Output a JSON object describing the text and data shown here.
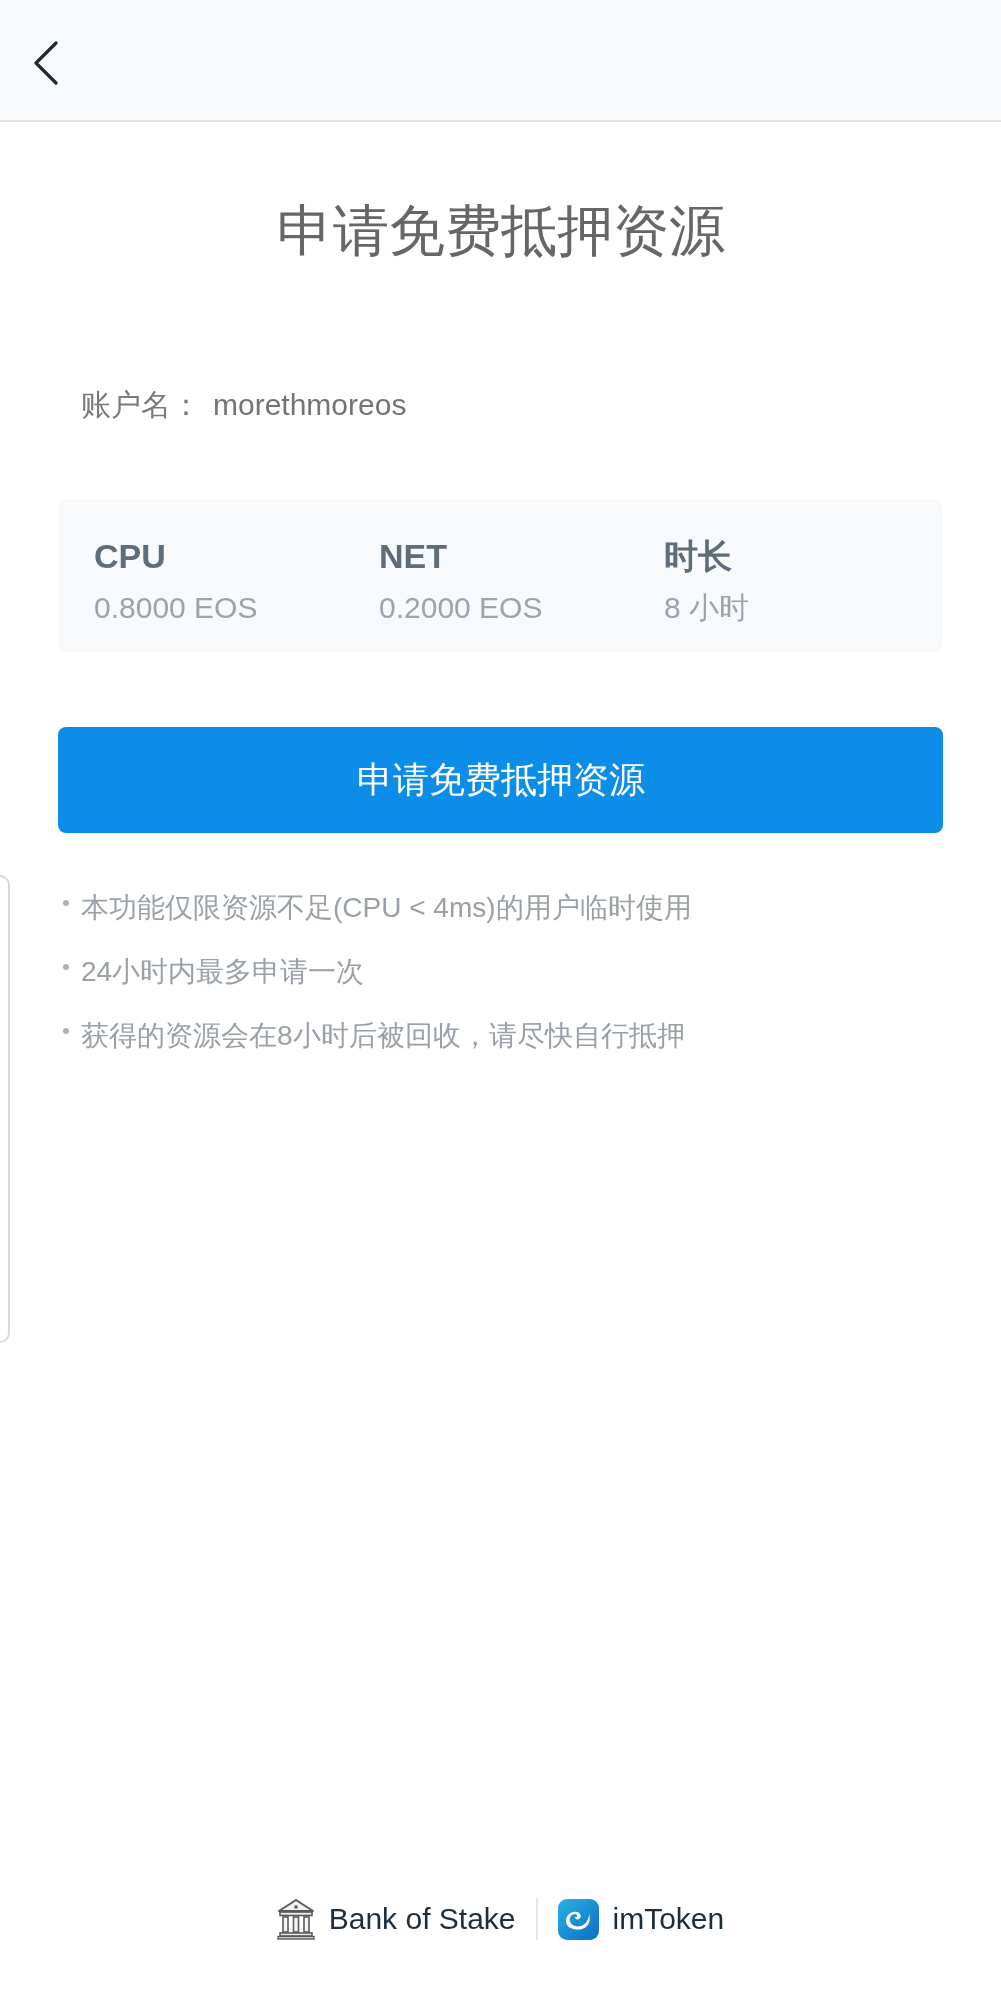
{
  "title": "申请免费抵押资源",
  "account": {
    "label": "账户名：",
    "value": "morethmoreos"
  },
  "resources": [
    {
      "label": "CPU",
      "value": "0.8000 EOS"
    },
    {
      "label": "NET",
      "value": "0.2000 EOS"
    },
    {
      "label": "时长",
      "value": "8 小时"
    }
  ],
  "submit_button": "申请免费抵押资源",
  "notes": [
    "本功能仅限资源不足(CPU < 4ms)的用户临时使用",
    "24小时内最多申请一次",
    "获得的资源会在8小时后被回收，请尽快自行抵押"
  ],
  "footer": {
    "partners": [
      {
        "kind": "building",
        "name": "Bank of Stake"
      },
      {
        "kind": "app",
        "name": "imToken"
      }
    ]
  }
}
